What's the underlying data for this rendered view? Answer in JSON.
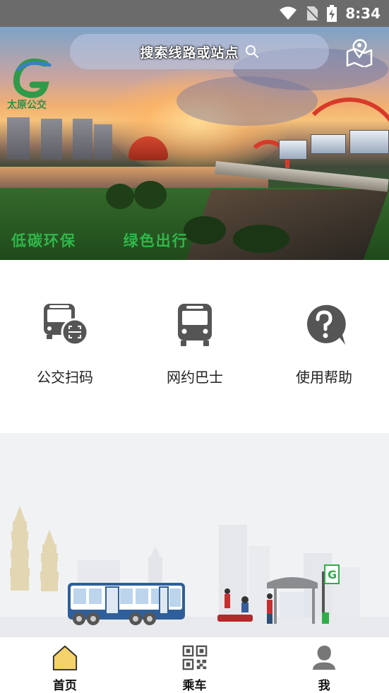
{
  "status_bar": {
    "time": "8:34",
    "icons": [
      "wifi-icon",
      "no-sim-icon",
      "battery-charging-icon"
    ]
  },
  "header": {
    "search_placeholder": "搜索线路或站点",
    "search_icon": "search-icon",
    "map_icon": "map-pin-icon",
    "logo_text": "太原公交",
    "slogan_part1": "低碳环保",
    "slogan_part2": "绿色出行"
  },
  "features": [
    {
      "label": "公交扫码",
      "icon": "bus-scan-icon"
    },
    {
      "label": "网约巴士",
      "icon": "bus-icon"
    },
    {
      "label": "使用帮助",
      "icon": "help-icon"
    }
  ],
  "bottom_nav": {
    "tabs": [
      {
        "label": "首页",
        "icon": "home-icon",
        "active": true
      },
      {
        "label": "乘车",
        "icon": "qr-code-icon",
        "active": false
      },
      {
        "label": "我",
        "icon": "profile-icon",
        "active": false
      }
    ]
  },
  "colors": {
    "accent_green": "#2fb84a",
    "home_active_fill": "#f5d26a",
    "status_bar": "#6b6b6b"
  }
}
